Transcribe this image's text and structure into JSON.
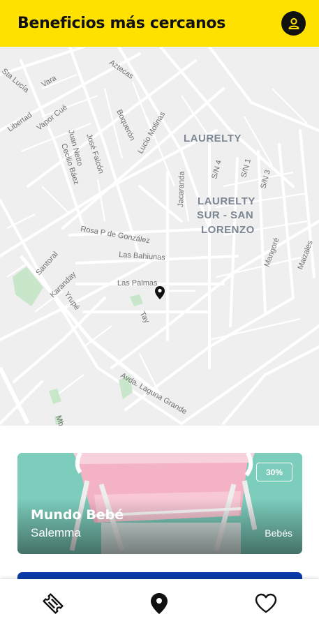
{
  "header": {
    "title": "Beneficios más cercanos",
    "user_icon": "user-icon"
  },
  "map": {
    "streets": [
      "Aztecas",
      "Vara",
      "Sta Lucía",
      "Libertad",
      "Vapor Cué",
      "Boquerón",
      "Juan Netto",
      "José Falcón",
      "Cecilio Báez",
      "Lucio Molinas",
      "Jacaranda",
      "S/N 4",
      "S/N 1",
      "S/N 3",
      "Rosa P de González",
      "Las Bahiunas",
      "Santoral",
      "Karanday",
      "Yrupé",
      "Las Palmas",
      "Tay",
      "Mangoré",
      "Maizales",
      "Avda. Laguna Grande",
      "Mb"
    ],
    "districts": [
      "LAURELTY",
      "LAURELTY",
      "SUR - SAN",
      "LORENZO"
    ],
    "pin_icon": "map-pin-icon"
  },
  "cards": [
    {
      "title": "Mundo Bebé",
      "subtitle": "Salemma",
      "category": "Bebés",
      "discount": "30%",
      "color": "#7ccdbc"
    }
  ],
  "nav": {
    "items": [
      {
        "icon": "ticket-icon"
      },
      {
        "icon": "location-icon"
      },
      {
        "icon": "heart-icon"
      }
    ]
  },
  "colors": {
    "accent": "#FFE100",
    "card2": "#0a3aa8"
  }
}
